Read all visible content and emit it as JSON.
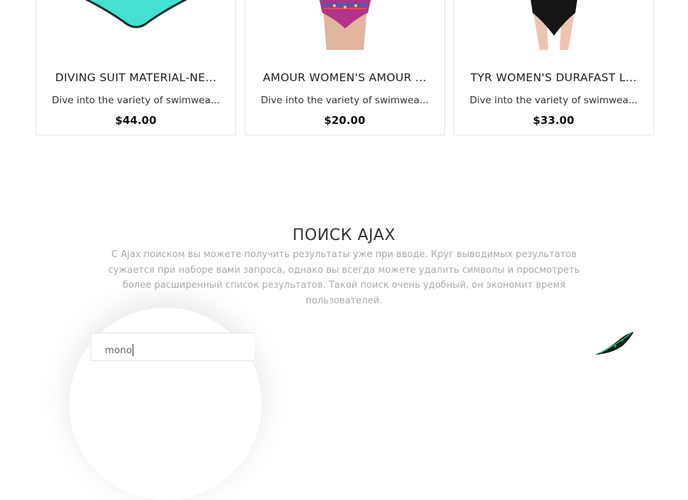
{
  "products": [
    {
      "title": "DIVING SUIT MATERIAL-NE...",
      "description": "Dive into the variety of swimwea...",
      "price": "$44.00",
      "image_icon": "teal-bikini-bottom"
    },
    {
      "title": "AMOUR WOMEN'S AMOUR ...",
      "description": "Dive into the variety of swimwea...",
      "price": "$20.00",
      "image_icon": "patterned-bikini-bottom"
    },
    {
      "title": "TYR WOMEN'S DURAFAST L...",
      "description": "Dive into the variety of swimwea...",
      "price": "$33.00",
      "image_icon": "black-swimsuit"
    }
  ],
  "ajax_search": {
    "title": "ПОИСК AJAX",
    "description": "С Ajax поиском вы можете получить результаты уже при вводе. Круг выводимых результатов сужается при наборе вами запроса, однако вы всегда можете удалить символы и просмотреть более расширенный список результатов. Такой поиск очень удобный, он экономит время пользователей.",
    "input_value": "mono"
  },
  "colors": {
    "accent_teal": "#45e0cf",
    "text_dark": "#222222",
    "text_muted": "#aaaaaa",
    "border": "#e3e3e3"
  }
}
